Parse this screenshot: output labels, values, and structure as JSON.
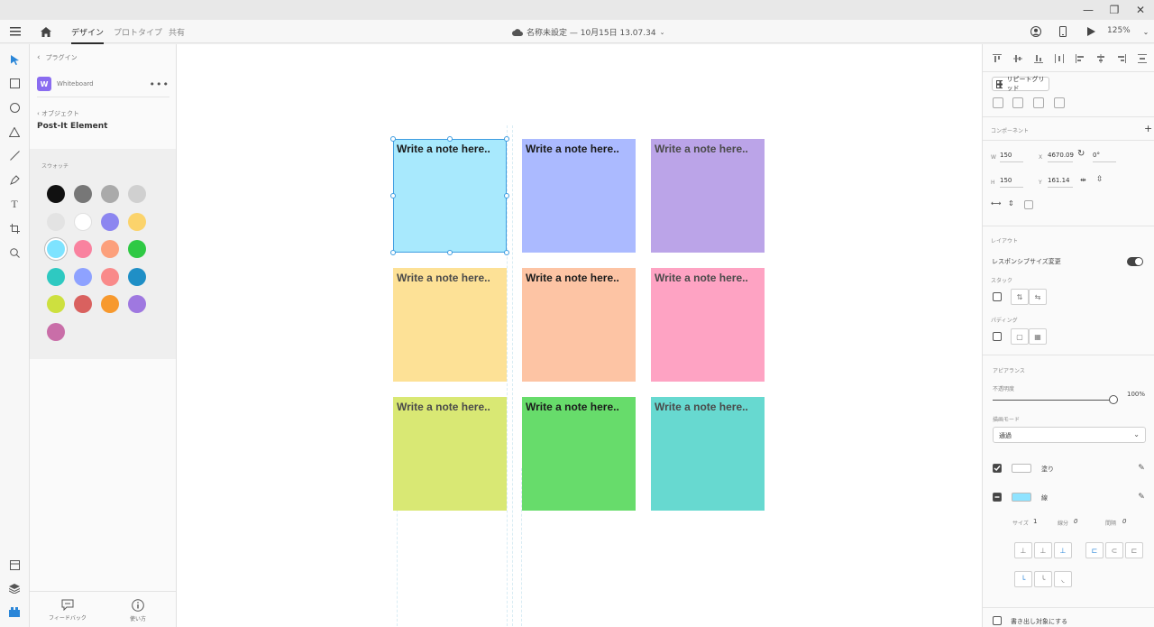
{
  "window": {
    "minimize": "—",
    "restore": "❐",
    "close": "✕"
  },
  "topbar": {
    "tabs": [
      {
        "label": "デザイン",
        "active": true
      },
      {
        "label": "プロトタイプ",
        "active": false
      },
      {
        "label": "共有",
        "active": false
      }
    ],
    "doc_title": "名称未設定 — 10月15日 13.07.34",
    "zoom": "125%"
  },
  "plugin_panel": {
    "back_label": "プラグイン",
    "plugin_name": "Whiteboard",
    "more": "•••",
    "crumb": "‹ オブジェクト",
    "title": "Post-It Element",
    "swatch_label": "スウォッチ",
    "swatches": [
      "#111111",
      "#777777",
      "#aaaaaa",
      "#d0d0d0",
      "#e3e3e3",
      "#ffffff",
      "#8c86f0",
      "#fbd36b",
      "#7ee3ff",
      "#f9829f",
      "#fca07c",
      "#2fc944",
      "#2ec9c1",
      "#8ea2ff",
      "#f98a8a",
      "#1f8fc6",
      "#cde03f",
      "#d9615f",
      "#f7992e",
      "#9f78e0",
      "#c96ea8"
    ],
    "selected_swatch": 8,
    "feedback_label": "フィードバック",
    "howto_label": "使い方"
  },
  "notes": [
    {
      "text": "Write a note here..",
      "color": "#a8e9fd",
      "dim": false,
      "selected": true
    },
    {
      "text": "Write a note here..",
      "color": "#abbaff",
      "dim": false,
      "selected": false
    },
    {
      "text": "Write a note here..",
      "color": "#bba4e8",
      "dim": true,
      "selected": false
    },
    {
      "text": "Write a note here..",
      "color": "#fde196",
      "dim": true,
      "selected": false
    },
    {
      "text": "Write a note here..",
      "color": "#fdc4a4",
      "dim": false,
      "selected": false
    },
    {
      "text": "Write a note here..",
      "color": "#fea3c3",
      "dim": true,
      "selected": false
    },
    {
      "text": "Write a note here..",
      "color": "#d9e874",
      "dim": true,
      "selected": false
    },
    {
      "text": "Write a note here..",
      "color": "#67dc6b",
      "dim": false,
      "selected": false
    },
    {
      "text": "Write a note here..",
      "color": "#67d9d0",
      "dim": true,
      "selected": false
    }
  ],
  "props": {
    "repeat_grid": "リピートグリッド",
    "component_label": "コンポーネント",
    "w_label": "W",
    "w_value": "150",
    "h_label": "H",
    "h_value": "150",
    "x_label": "X",
    "x_value": "4670.09",
    "y_label": "Y",
    "y_value": "161.14",
    "rotation": "0°",
    "layout_label": "レイアウト",
    "responsive_label": "レスポンシブサイズ変更",
    "stack_label": "スタック",
    "padding_label": "パディング",
    "appearance_label": "アピアランス",
    "opacity_label": "不透明度",
    "opacity_value": "100%",
    "opacity": 1.0,
    "blend_label": "描画モード",
    "blend_value": "通過",
    "fill_label": "塗り",
    "fill_color": "#ffffff",
    "stroke_label": "線",
    "stroke_color": "#8fe3ff",
    "size_label": "サイズ",
    "size_value": "1",
    "dash_label": "線分",
    "dash_value": "0",
    "gap_label": "間隔",
    "gap_value": "0",
    "export_label": "書き出し対象にする"
  }
}
